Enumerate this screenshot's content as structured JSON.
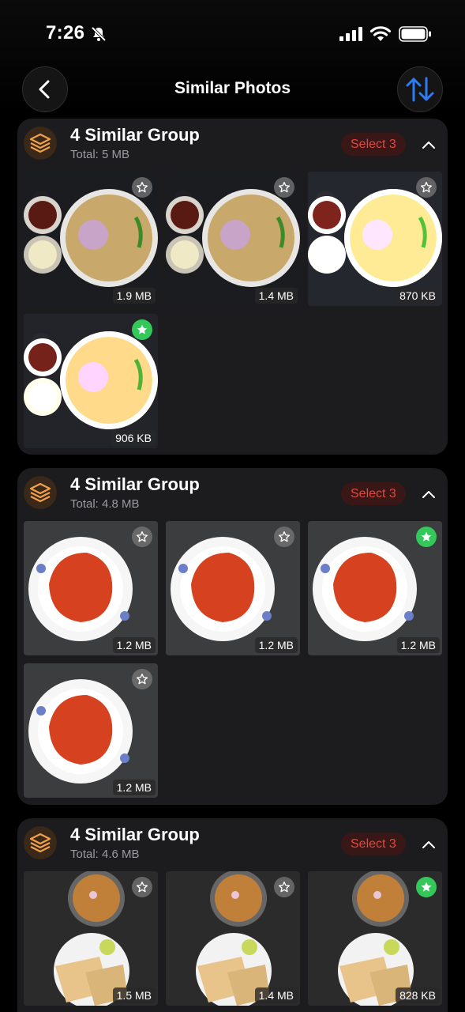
{
  "status": {
    "time": "7:26"
  },
  "nav": {
    "title": "Similar Photos"
  },
  "groups": [
    {
      "title": "4 Similar Group",
      "total": "Total: 5 MB",
      "select_label": "Select 3",
      "photos": [
        {
          "size": "1.9 MB",
          "starred": false
        },
        {
          "size": "1.4 MB",
          "starred": false
        },
        {
          "size": "870 KB",
          "starred": false
        },
        {
          "size": "906 KB",
          "starred": true
        }
      ]
    },
    {
      "title": "4 Similar Group",
      "total": "Total: 4.8 MB",
      "select_label": "Select 3",
      "photos": [
        {
          "size": "1.2 MB",
          "starred": false
        },
        {
          "size": "1.2 MB",
          "starred": false
        },
        {
          "size": "1.2 MB",
          "starred": true
        },
        {
          "size": "1.2 MB",
          "starred": false
        }
      ]
    },
    {
      "title": "4 Similar Group",
      "total": "Total: 4.6 MB",
      "select_label": "Select 3",
      "photos": [
        {
          "size": "1.5 MB",
          "starred": false
        },
        {
          "size": "1.4 MB",
          "starred": false
        },
        {
          "size": "828 KB",
          "starred": true
        }
      ]
    }
  ],
  "colors": {
    "accent": "#e0493f",
    "star_on": "#34c759",
    "sort_icon": "#2f7bf5",
    "group_icon": "#f0a04b"
  }
}
